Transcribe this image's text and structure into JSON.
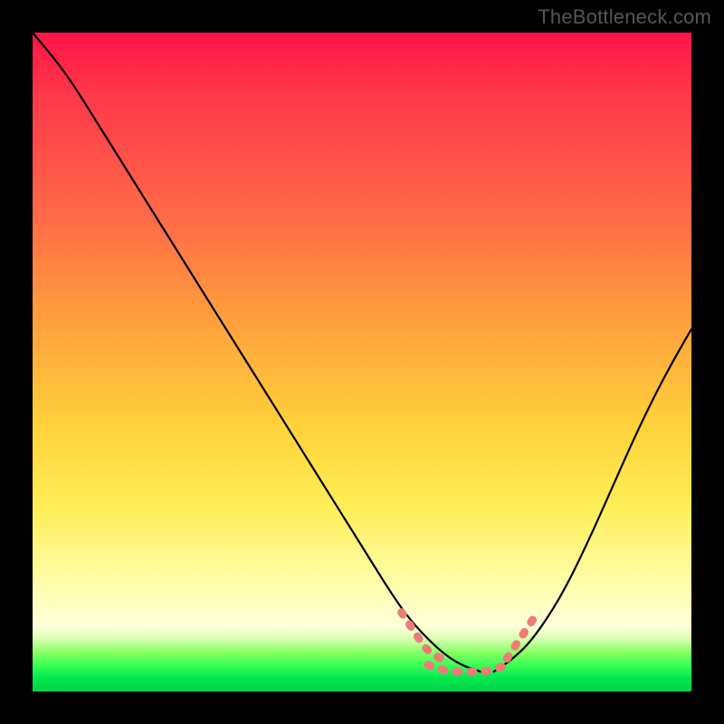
{
  "watermark": "TheBottleneck.com",
  "chart_data": {
    "type": "line",
    "title": "",
    "xlabel": "",
    "ylabel": "",
    "xlim": [
      0,
      100
    ],
    "ylim": [
      0,
      100
    ],
    "grid": false,
    "legend": false,
    "description": "Bottleneck-style V-curve: left black curve descending from top-left to a flat minimum around x≈60–70, right black curve rising toward top-right. Pink dashed segments highlight the valley region.",
    "series": [
      {
        "name": "left-curve",
        "color": "#000000",
        "style": "solid",
        "x": [
          0,
          5,
          10,
          15,
          20,
          25,
          30,
          35,
          40,
          45,
          50,
          55,
          58,
          62,
          65,
          68
        ],
        "y": [
          100,
          94,
          86,
          78,
          70,
          62,
          54,
          46,
          38,
          30,
          22,
          14,
          10,
          6,
          4,
          3
        ]
      },
      {
        "name": "right-curve",
        "color": "#000000",
        "style": "solid",
        "x": [
          70,
          73,
          76,
          80,
          84,
          88,
          92,
          96,
          100
        ],
        "y": [
          3,
          5,
          8,
          14,
          22,
          31,
          40,
          48,
          55
        ]
      },
      {
        "name": "valley-left-marker",
        "color": "#ee7b78",
        "style": "dashed",
        "x": [
          56,
          58,
          60,
          62
        ],
        "y": [
          12,
          9,
          6,
          5
        ]
      },
      {
        "name": "valley-floor-marker",
        "color": "#ee7b78",
        "style": "dashed",
        "x": [
          60,
          63,
          66,
          69,
          72
        ],
        "y": [
          4,
          3,
          3,
          3,
          4
        ]
      },
      {
        "name": "valley-right-marker",
        "color": "#ee7b78",
        "style": "dashed",
        "x": [
          72,
          74,
          76
        ],
        "y": [
          5,
          8,
          11
        ]
      }
    ],
    "gradient_background": {
      "top": "#ff1446",
      "mid": "#ffd23a",
      "bottom": "#00d24a"
    }
  }
}
